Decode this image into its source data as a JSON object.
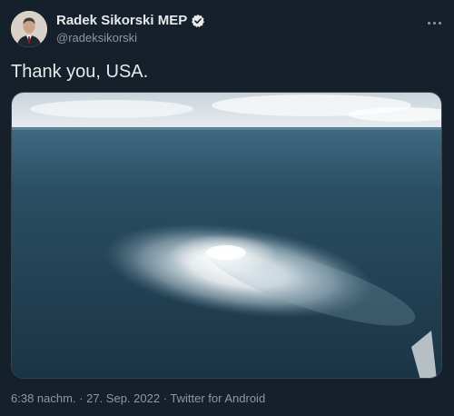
{
  "tweet": {
    "author": {
      "display_name": "Radek Sikorski MEP",
      "handle": "@radeksikorski",
      "verified": true
    },
    "text": "Thank you, USA.",
    "media": {
      "icon": "photo-sea-gas-leak"
    },
    "meta": {
      "time": "6:38 nachm.",
      "separator": " · ",
      "date": "27. Sep. 2022",
      "source": "Twitter for Android"
    }
  },
  "colors": {
    "background": "#15202b",
    "text": "#e7e9ea",
    "secondary": "#8b98a5",
    "verified": "#e7e9ea"
  }
}
